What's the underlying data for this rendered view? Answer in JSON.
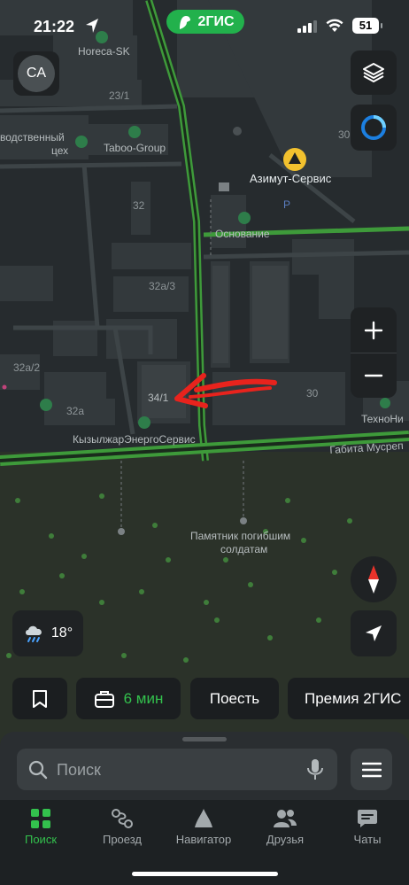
{
  "status_bar": {
    "time": "21:22",
    "brand": "2ГИС",
    "battery": "51"
  },
  "profile": {
    "initials": "CA"
  },
  "map": {
    "labels": {
      "horeca": "Horeca-SK",
      "b23_1": "23/1",
      "vodstvenny": "водственный",
      "tseh": "цех",
      "taboo": "Taboo-Group",
      "azimut": "Азимут-Сервис",
      "b30_top": "30",
      "b32": "32",
      "osnovanie": "Основание",
      "parking": "P",
      "b32a_3": "32а/3",
      "b32a_2": "32а/2",
      "b34_1": "34/1",
      "b30": "30",
      "b32a": "32а",
      "tehno": "ТехноНи",
      "kyzyl": "КызылжарЭнергоСервис",
      "street": "Габита Мусреп",
      "monument_1": "Памятник погибшим",
      "monument_2": "солдатам"
    }
  },
  "weather": {
    "temp": "18°",
    "icon": "rain-cloud-icon"
  },
  "chips": {
    "commute_time": "6 мин",
    "eat": "Поесть",
    "premium": "Премия 2ГИС"
  },
  "search": {
    "placeholder": "Поиск"
  },
  "tabs": [
    {
      "label": "Поиск",
      "icon": "grid-icon"
    },
    {
      "label": "Проезд",
      "icon": "route-icon"
    },
    {
      "label": "Навигатор",
      "icon": "navigator-icon"
    },
    {
      "label": "Друзья",
      "icon": "friends-icon"
    },
    {
      "label": "Чаты",
      "icon": "chat-icon"
    }
  ],
  "colors": {
    "accent": "#33c14d",
    "road_green": "#3e9a3a",
    "annotation_arrow": "#e8231d"
  }
}
